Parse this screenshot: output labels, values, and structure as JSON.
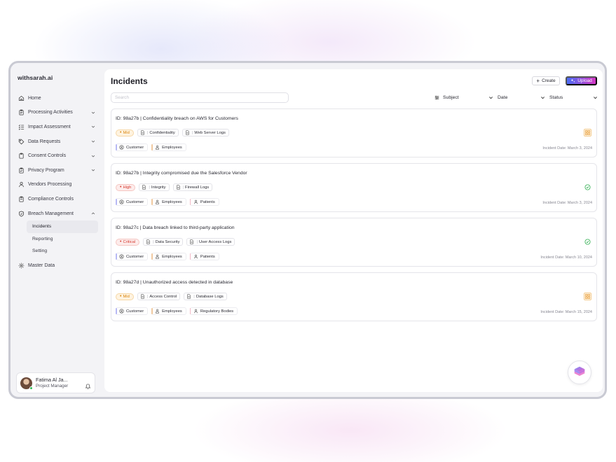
{
  "app": {
    "brand": "withsarah.ai"
  },
  "sidebar": {
    "items": [
      {
        "label": "Home",
        "icon": "home-icon",
        "chevron": false
      },
      {
        "label": "Processing Activities",
        "icon": "clipboard-icon",
        "chevron": true
      },
      {
        "label": "Impact Assessment",
        "icon": "list-check-icon",
        "chevron": true
      },
      {
        "label": "Data Requests",
        "icon": "tag-icon",
        "chevron": true
      },
      {
        "label": "Consent Controls",
        "icon": "clipboard-icon",
        "chevron": true
      },
      {
        "label": "Privacy Program",
        "icon": "clipboard-icon",
        "chevron": true
      },
      {
        "label": "Vendors Processing",
        "icon": "person-icon",
        "chevron": false
      },
      {
        "label": "Compliance Controls",
        "icon": "clipboard-icon",
        "chevron": false
      },
      {
        "label": "Breach Management",
        "icon": "shield-icon",
        "chevron": true,
        "expanded": true
      },
      {
        "label": "Master Data",
        "icon": "gear-icon",
        "chevron": false
      }
    ],
    "breach_sub": [
      {
        "label": "Incidents",
        "active": true
      },
      {
        "label": "Reporting",
        "active": false
      },
      {
        "label": "Setting",
        "active": false
      }
    ],
    "user": {
      "name": "Fatima Al Ja...",
      "role": "Project Manager",
      "status_color": "#2fbf5a"
    }
  },
  "header": {
    "title": "Incidents",
    "create_label": "Create",
    "upload_label": "Upload"
  },
  "search": {
    "placeholder": "Search",
    "value": ""
  },
  "filters": {
    "subject": "Subject",
    "date": "Date",
    "status": "Status"
  },
  "incidents": [
    {
      "title": "ID: 98a27b  | Confidentiality breach on AWS for Customers",
      "severity": "Mid",
      "category": "Confidentiality",
      "source": "Web Server Logs",
      "parties": [
        "Customer",
        "Employees"
      ],
      "date": "Incident Date: March 3, 2024",
      "status": "pending"
    },
    {
      "title": "ID: 98a27b  | Integrity compromised  due the Salesforce Vendor",
      "severity": "High",
      "category": "Integrity",
      "source": "Firewall Logs",
      "parties": [
        "Customer",
        "Employees",
        "Patients"
      ],
      "date": "Incident Date: March 3, 2024",
      "status": "resolved"
    },
    {
      "title": "ID: 98a27c  | Data breach linked to third-party application",
      "severity": "Critical",
      "category": "Data Security",
      "source": "User Access Logs",
      "parties": [
        "Customer",
        "Employees",
        "Patients"
      ],
      "date": "Incident Date: March 10, 2024",
      "status": "resolved"
    },
    {
      "title": "ID: 98a27d  | Unauthorized access detected in database",
      "severity": "Mid",
      "category": "Access Control",
      "source": "Database Logs",
      "parties": [
        "Customer",
        "Employees",
        "Regulatory Bodies"
      ],
      "date": "Incident Date: March 15, 2024",
      "status": "pending"
    }
  ],
  "colors": {
    "accent_gradient_start": "#4a6cf5",
    "accent_gradient_end": "#d536c4",
    "severity_mid": "#d9850d",
    "severity_high": "#d63c32",
    "status_resolved": "#2fae4f",
    "status_pending": "#e99a2c"
  }
}
